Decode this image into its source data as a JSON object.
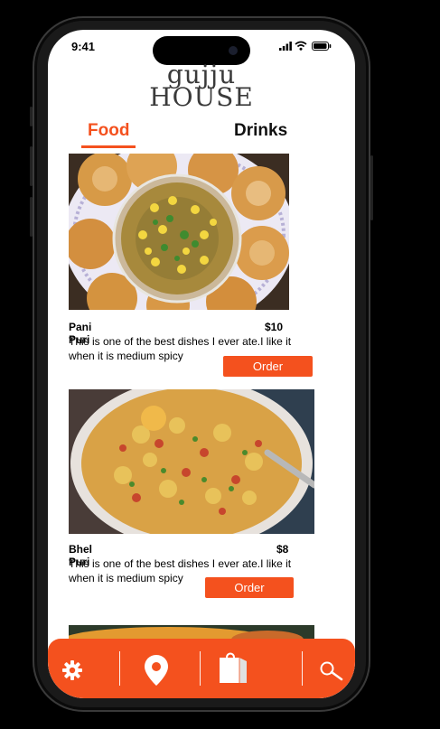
{
  "status": {
    "time": "9:41"
  },
  "brand": {
    "line1": "gujju",
    "line2": "HOUSE"
  },
  "tabs": [
    {
      "label": "Food"
    },
    {
      "label": "Drinks"
    }
  ],
  "menu": [
    {
      "name": "Pani Puri",
      "price": "$10",
      "description": "This is one of the best dishes I ever ate.I like it when it is medium spicy",
      "order_label": "Order"
    },
    {
      "name": "Bhel Puri",
      "price": "$8",
      "description": "This is one of the best dishes I ever ate.I like it when it is medium spicy",
      "order_label": "Order"
    }
  ],
  "bottom_nav": [
    {
      "icon": "settings-icon"
    },
    {
      "icon": "location-pin-icon"
    },
    {
      "icon": "shopping-bag-icon"
    },
    {
      "icon": "search-icon"
    }
  ],
  "colors": {
    "accent": "#f4511e",
    "brand_text": "#3a3a3a"
  }
}
